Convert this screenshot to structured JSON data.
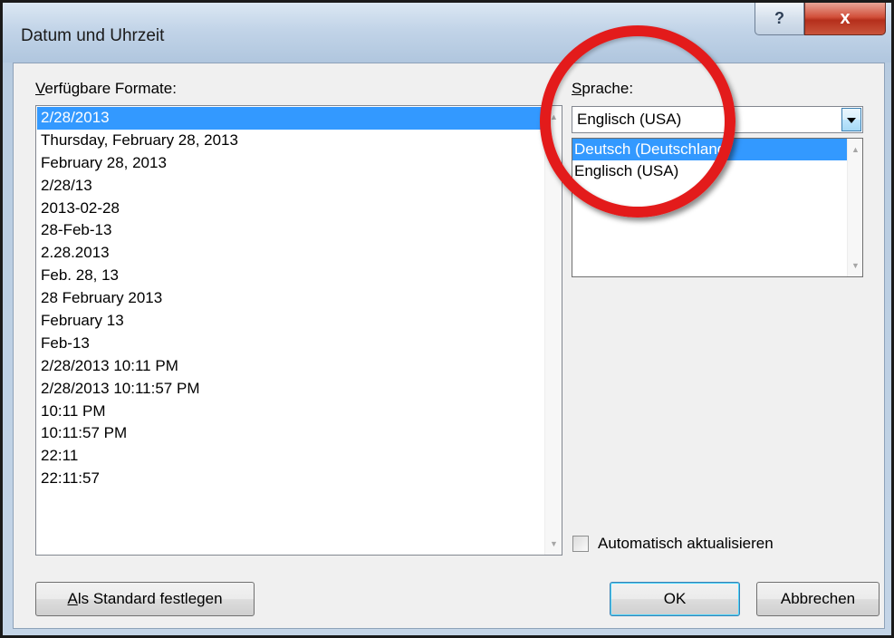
{
  "window": {
    "title": "Datum und Uhrzeit",
    "help_label": "?",
    "close_label": "x"
  },
  "formats": {
    "label_mnemonic": "V",
    "label_rest": "erfügbare Formate:",
    "items": [
      "2/28/2013",
      "Thursday, February 28, 2013",
      "February 28, 2013",
      "2/28/13",
      "2013-02-28",
      "28-Feb-13",
      "2.28.2013",
      "Feb. 28, 13",
      "28 February 2013",
      "February 13",
      "Feb-13",
      "2/28/2013 10:11 PM",
      "2/28/2013 10:11:57 PM",
      "10:11 PM",
      "10:11:57 PM",
      "22:11",
      "22:11:57"
    ],
    "selected_index": 0
  },
  "language": {
    "label_mnemonic": "S",
    "label_rest": "prache:",
    "selected_value": "Englisch (USA)",
    "options": [
      "Deutsch (Deutschland)",
      "Englisch (USA)"
    ],
    "highlighted_index": 0
  },
  "auto_update": {
    "label_mnemonic": "A",
    "label_rest": "utomatisch aktualisieren",
    "checked": false
  },
  "buttons": {
    "set_default_mnemonic": "A",
    "set_default_rest": "ls Standard festlegen",
    "ok": "OK",
    "cancel": "Abbrechen"
  },
  "annotation": {
    "highlight_color": "#e31b1b"
  },
  "icons": {
    "scroll_up": "▲",
    "scroll_down": "▼"
  }
}
